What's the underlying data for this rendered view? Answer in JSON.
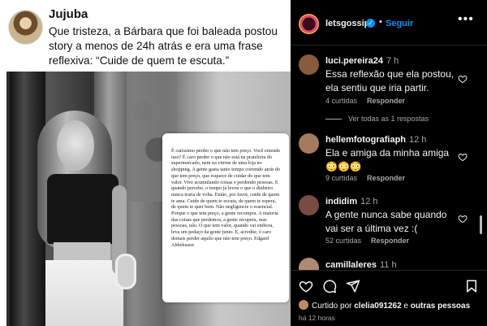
{
  "tweet": {
    "name": "Jujuba",
    "text": "Que tristeza, a Bárbara que foi baleada postou story a menos de 24h atrás e era uma frase reflexiva: “Cuide de quem te escuta.”"
  },
  "story": {
    "note": "É caríssimo perder o que não tem preço. Você entende isso? É caro perder o que não está na prateleira do supermercado, nem na vitrine de uma loja no shopping. A gente gasta tanto tempo correndo atrás do que tem preço, que esquece de cuidar do que tem valor. Vive acumulando coisas e perdendo pessoas. E quando percebe, o tempo já levou o que o dinheiro nunca traria de volta. Então, por favor, cuide de quem te ama. Cuide de quem te escuta, de quem te espera, de quem te quer bem. Não negligencie o essencial. Porque o que tem preço, a gente recompra. A maioria das coisas que perdemos, a gente recupera, mas pessoas, não. O que tem valor, quando vai embora, leva um pedaço da gente junto. E, acredite, é caro demais perder aquilo que não tem preço. Edgard Abbehusen"
  },
  "header": {
    "username": "letsgossip",
    "separator": "•",
    "follow_label": "Seguir",
    "more_icon": "more-options-icon"
  },
  "comments": [
    {
      "username": "luci.pereira24",
      "time": "7 h",
      "text": "Essa reflexão que ela postou, ela sentiu que iria partir.",
      "likes": "4 curtidas",
      "reply": "Responder",
      "view_replies": "Ver todas as 1 respostas",
      "avatar_color": "#8a5a3c"
    },
    {
      "username": "hellemfotografiaph",
      "time": "12 h",
      "text": "Ela e amiga da minha amiga",
      "emoji": "😳😳😳",
      "likes": "9 curtidas",
      "reply": "Responder",
      "avatar_color": "#a57a5e"
    },
    {
      "username": "indidim",
      "time": "12 h",
      "text": "A gente nunca sabe quando vai ser a última vez :(",
      "likes": "52 curtidas",
      "reply": "Responder",
      "avatar_color": "#7a4a44"
    },
    {
      "username": "camillaleres",
      "time": "11 h",
      "avatar_color": "#b08a70"
    }
  ],
  "footer": {
    "liked_by_prefix": "Curtido por",
    "liked_by_user": "clelia091262",
    "liked_by_conj": "e",
    "liked_by_others": "outras pessoas",
    "posted_time": "há 12 horas"
  },
  "colors": {
    "background": "#000000",
    "accent": "#0095f6",
    "muted": "#a8a8a8",
    "text": "#f5f5f5"
  }
}
